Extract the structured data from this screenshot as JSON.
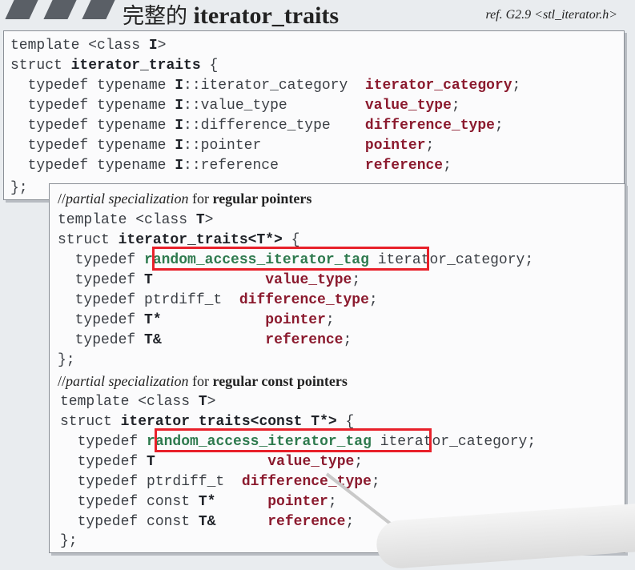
{
  "header": {
    "title_cjk": "完整的",
    "title_code": "iterator_traits",
    "ref": "ref. G2.9  <stl_iterator.h>"
  },
  "panel1": {
    "l1_kw": "template",
    "l1_rest": " <class ",
    "l1_t": "I",
    "l1_end": ">",
    "l2_kw": "struct",
    "l2_name": "iterator_traits",
    "l2_end": " {",
    "rows": [
      {
        "pre": "  typedef typename ",
        "i": "I",
        "mid": "::iterator_category  ",
        "res": "iterator_category",
        "end": ";"
      },
      {
        "pre": "  typedef typename ",
        "i": "I",
        "mid": "::value_type         ",
        "res": "value_type",
        "end": ";"
      },
      {
        "pre": "  typedef typename ",
        "i": "I",
        "mid": "::difference_type    ",
        "res": "difference_type",
        "end": ";"
      },
      {
        "pre": "  typedef typename ",
        "i": "I",
        "mid": "::pointer            ",
        "res": "pointer",
        "end": ";"
      },
      {
        "pre": "  typedef typename ",
        "i": "I",
        "mid": "::reference          ",
        "res": "reference",
        "end": ";"
      }
    ],
    "close": "};"
  },
  "panel2": {
    "c1_slash": "//",
    "c1_it": "partial specialization",
    "c1_for": " for ",
    "c1_b": "regular pointers",
    "t1": "template <class ",
    "t1_t": "T",
    "t1_end": ">",
    "s1_kw": "struct",
    "s1_name": "iterator_traits<T*>",
    "s1_end": " {",
    "a_tag": "random_access_iterator_tag",
    "a_rest": " iterator_category;",
    "rows1": [
      {
        "pre": "  typedef ",
        "t": "T",
        "pad": "             ",
        "res": "value_type",
        "end": ";"
      },
      {
        "pre": "  typedef ptrdiff_t  ",
        "t": "",
        "pad": "",
        "res": "difference_type",
        "end": ";"
      },
      {
        "pre": "  typedef ",
        "t": "T*",
        "pad": "            ",
        "res": "pointer",
        "end": ";"
      },
      {
        "pre": "  typedef ",
        "t": "T&",
        "pad": "            ",
        "res": "reference",
        "end": ";"
      }
    ],
    "close1": "};",
    "c2_slash": "//",
    "c2_it": "partial specialization",
    "c2_for": " for ",
    "c2_b": "regular const pointers",
    "t2": "template <class ",
    "t2_t": "T",
    "t2_end": ">",
    "s2_kw": "struct",
    "s2_name": "iterator traits<const T*>",
    "s2_end": " {",
    "b_tag": "random_access_iterator_tag",
    "b_rest": " iterator_category;",
    "rows2": [
      {
        "pre": "  typedef ",
        "t": "T",
        "pad": "             ",
        "res": "value_type",
        "end": ";"
      },
      {
        "pre": "  typedef ptrdiff_t  ",
        "t": "",
        "pad": "",
        "res": "difference_type",
        "end": ";"
      },
      {
        "pre": "  typedef const ",
        "t": "T*",
        "pad": "      ",
        "res": "pointer",
        "end": ";"
      },
      {
        "pre": "  typedef const ",
        "t": "T&",
        "pad": "      ",
        "res": "reference",
        "end": ";"
      }
    ],
    "close2": "};"
  }
}
